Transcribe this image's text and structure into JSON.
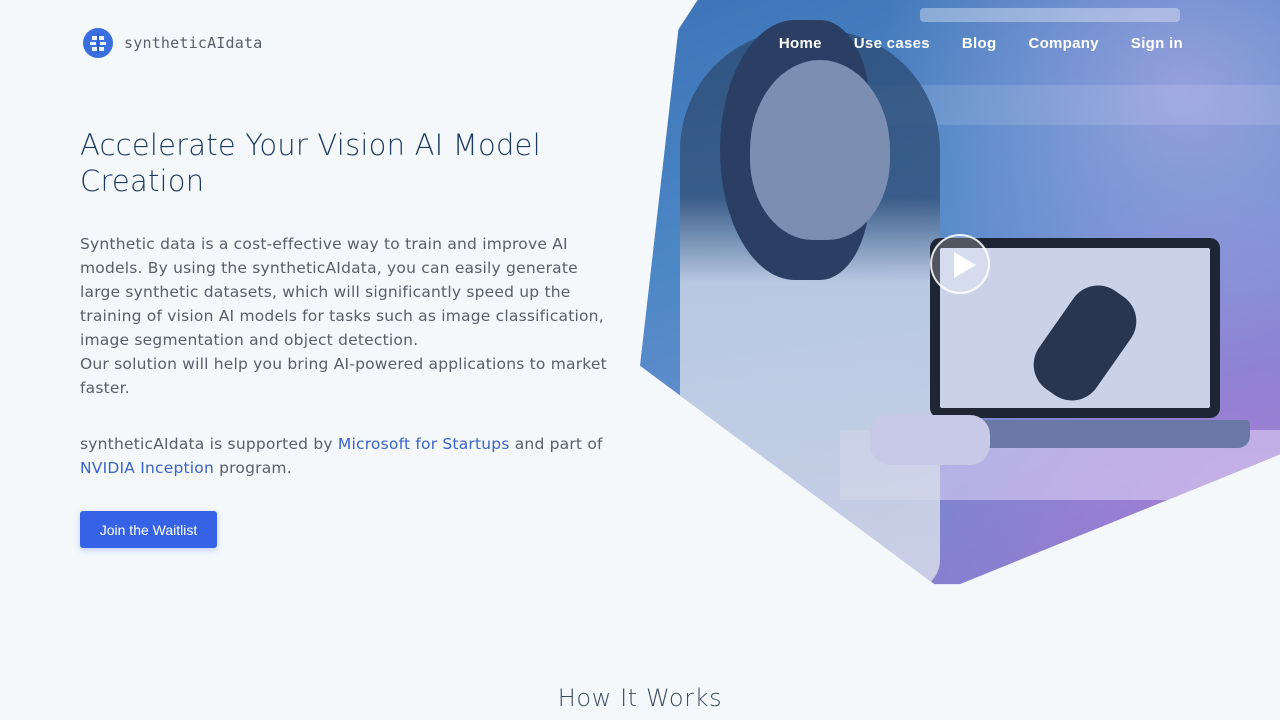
{
  "header": {
    "logo_text": "syntheticAIdata",
    "nav": [
      "Home",
      "Use cases",
      "Blog",
      "Company",
      "Sign in"
    ]
  },
  "hero": {
    "headline": "Accelerate Your Vision AI Model Creation",
    "description_1": "Synthetic data is a cost-effective way to train and improve AI models. By using the syntheticAIdata, you can easily generate large synthetic datasets, which will significantly speed up the training of vision AI models for tasks such as image classification, image segmentation and object detection.",
    "description_2": "Our solution will help you bring AI-powered applications to market faster.",
    "support_prefix": "syntheticAIdata is supported by ",
    "support_link_1": "Microsoft for Startups",
    "support_middle": " and part of ",
    "support_link_2": "NVIDIA Inception",
    "support_suffix": " program.",
    "cta_label": "Join the Waitlist"
  },
  "section": {
    "title": "How It Works"
  },
  "colors": {
    "accent": "#3663e6",
    "link": "#3a63c8",
    "headline": "#1e3a5f",
    "background": "#f4f8fb"
  },
  "icons": {
    "logo": "brain-icon",
    "video": "play-icon"
  }
}
